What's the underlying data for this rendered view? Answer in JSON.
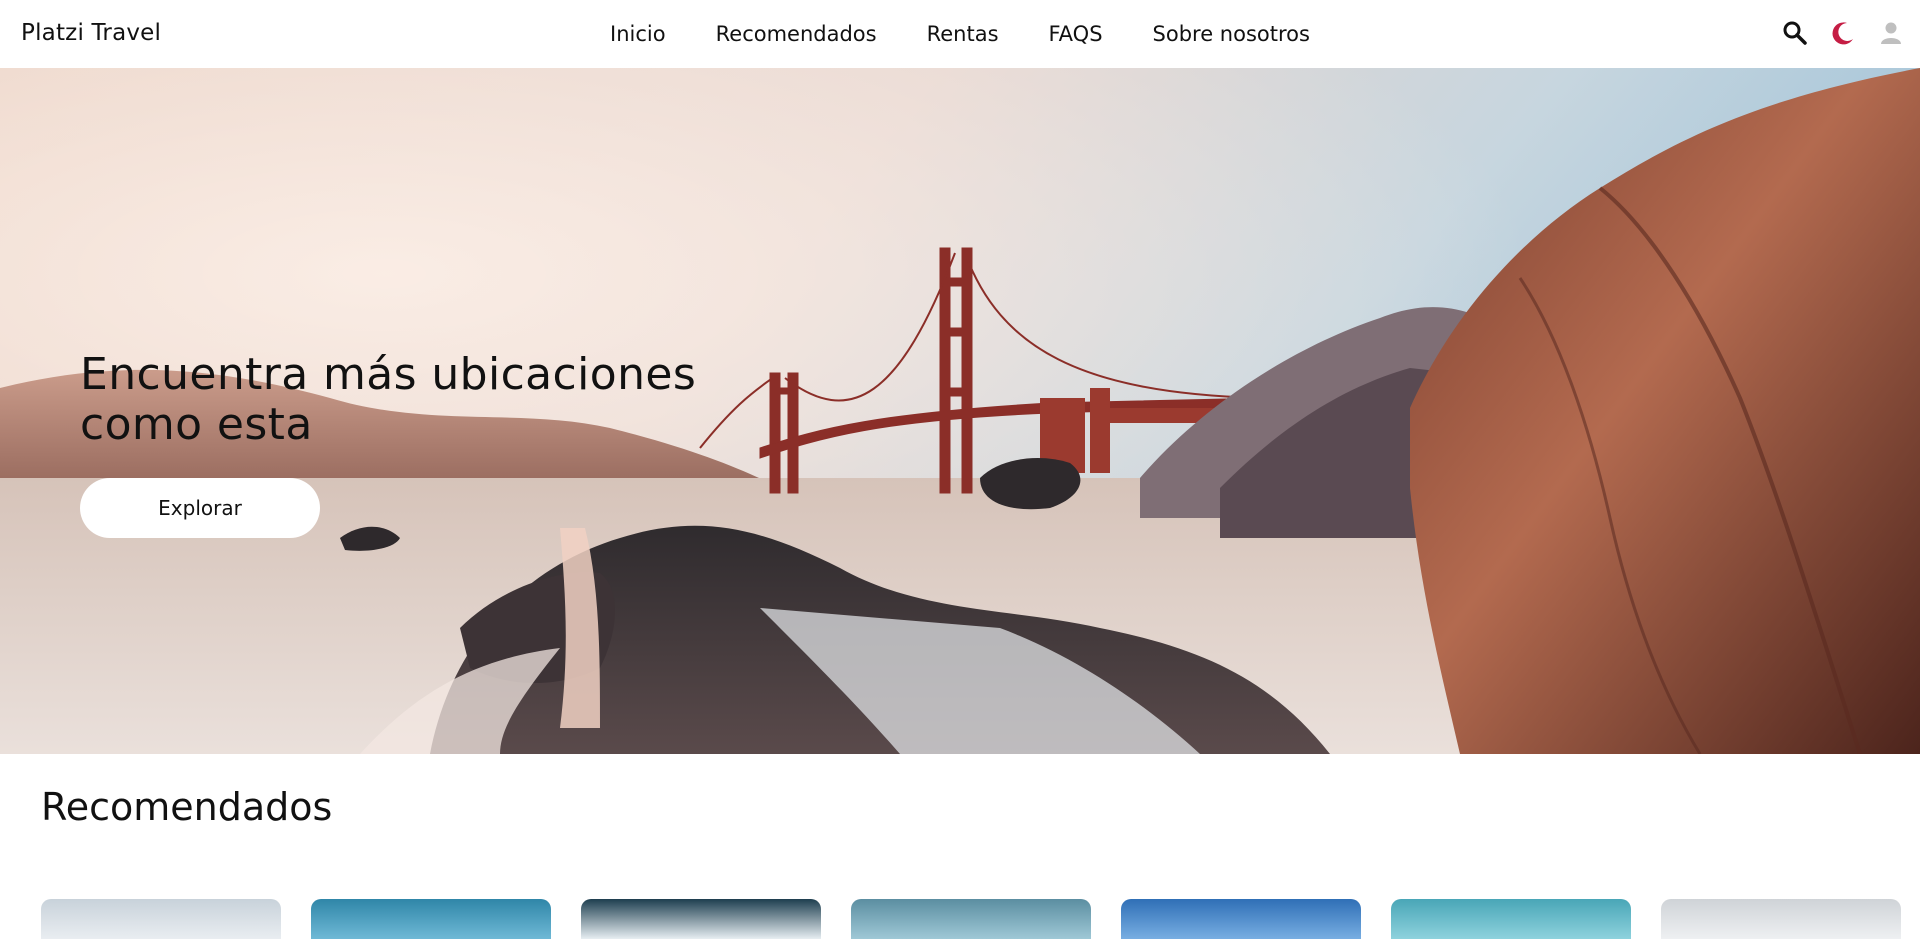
{
  "header": {
    "brand": "Platzi Travel",
    "nav": [
      "Inicio",
      "Recomendados",
      "Rentas",
      "FAQS",
      "Sobre nosotros"
    ],
    "icons": [
      "search-icon",
      "moon-icon",
      "user-icon"
    ]
  },
  "hero": {
    "title_line1": "Encuentra más ubicaciones",
    "title_line2": "como esta",
    "button_label": "Explorar"
  },
  "recommended": {
    "title": "Recomendados",
    "cards": [
      {
        "color_top": "#c8d2da",
        "color_bottom": "#e9edf1"
      },
      {
        "color_top": "#2f86a8",
        "color_bottom": "#6fb9d6"
      },
      {
        "color_top": "#1d3e4f",
        "color_bottom": "#e7eef2"
      },
      {
        "color_top": "#5b8ea1",
        "color_bottom": "#9fc8d6"
      },
      {
        "color_top": "#2f6fb6",
        "color_bottom": "#78aee2"
      },
      {
        "color_top": "#49a6b7",
        "color_bottom": "#8ed2dd"
      },
      {
        "color_top": "#cfd3d7",
        "color_bottom": "#eef0f2"
      }
    ]
  },
  "colors": {
    "accent_moon": "#c51d44",
    "user_icon": "#bfbfbf",
    "text": "#111111"
  }
}
